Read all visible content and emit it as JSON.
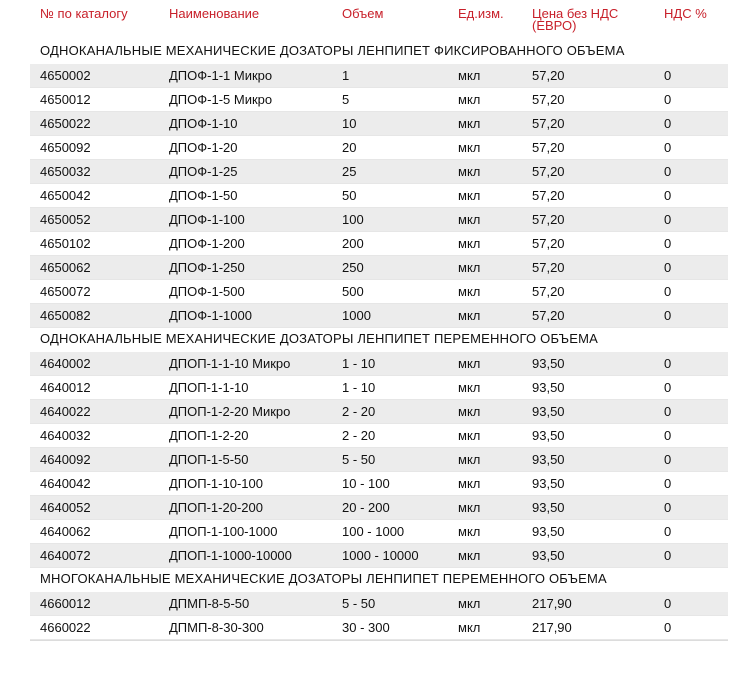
{
  "headers": {
    "catalog": "№ по каталогу",
    "name": "Наименование",
    "volume": "Объем",
    "unit": "Ед.изм.",
    "price": "Цена без НДС (ЕВРО)",
    "vat": "НДС %"
  },
  "accent_color": "#c8202a",
  "sections": [
    {
      "title": "ОДНОКАНАЛЬНЫЕ  МЕХАНИЧЕСКИЕ  ДОЗАТОРЫ  ЛЕНПИПЕТ  ФИКСИРОВАННОГО  ОБЪЕМА",
      "rows": [
        {
          "catalog": "4650002",
          "name": "ДПОФ-1-1 Микро",
          "volume": "1",
          "unit": "мкл",
          "price": "57,20",
          "vat": "0"
        },
        {
          "catalog": "4650012",
          "name": "ДПОФ-1-5 Микро",
          "volume": "5",
          "unit": "мкл",
          "price": "57,20",
          "vat": "0"
        },
        {
          "catalog": "4650022",
          "name": "ДПОФ-1-10",
          "volume": "10",
          "unit": "мкл",
          "price": "57,20",
          "vat": "0"
        },
        {
          "catalog": "4650092",
          "name": "ДПОФ-1-20",
          "volume": "20",
          "unit": "мкл",
          "price": "57,20",
          "vat": "0"
        },
        {
          "catalog": "4650032",
          "name": "ДПОФ-1-25",
          "volume": "25",
          "unit": "мкл",
          "price": "57,20",
          "vat": "0"
        },
        {
          "catalog": "4650042",
          "name": "ДПОФ-1-50",
          "volume": "50",
          "unit": "мкл",
          "price": "57,20",
          "vat": "0"
        },
        {
          "catalog": "4650052",
          "name": "ДПОФ-1-100",
          "volume": "100",
          "unit": "мкл",
          "price": "57,20",
          "vat": "0"
        },
        {
          "catalog": "4650102",
          "name": "ДПОФ-1-200",
          "volume": "200",
          "unit": "мкл",
          "price": "57,20",
          "vat": "0"
        },
        {
          "catalog": "4650062",
          "name": "ДПОФ-1-250",
          "volume": "250",
          "unit": "мкл",
          "price": "57,20",
          "vat": "0"
        },
        {
          "catalog": "4650072",
          "name": "ДПОФ-1-500",
          "volume": "500",
          "unit": "мкл",
          "price": "57,20",
          "vat": "0"
        },
        {
          "catalog": "4650082",
          "name": "ДПОФ-1-1000",
          "volume": "1000",
          "unit": "мкл",
          "price": "57,20",
          "vat": "0"
        }
      ]
    },
    {
      "title": "ОДНОКАНАЛЬНЫЕ МЕХАНИЧЕСКИЕ  ДОЗАТОРЫ  ЛЕНПИПЕТ  ПЕРЕМЕННОГО  ОБЪЕМА",
      "rows": [
        {
          "catalog": "4640002",
          "name": "ДПОП-1-1-10 Микро",
          "volume": "1 - 10",
          "unit": "мкл",
          "price": "93,50",
          "vat": "0"
        },
        {
          "catalog": "4640012",
          "name": "ДПОП-1-1-10",
          "volume": "1 - 10",
          "unit": "мкл",
          "price": "93,50",
          "vat": "0"
        },
        {
          "catalog": "4640022",
          "name": "ДПОП-1-2-20 Микро",
          "volume": "2 - 20",
          "unit": "мкл",
          "price": "93,50",
          "vat": "0"
        },
        {
          "catalog": "4640032",
          "name": "ДПОП-1-2-20",
          "volume": "2 - 20",
          "unit": "мкл",
          "price": "93,50",
          "vat": "0"
        },
        {
          "catalog": "4640092",
          "name": "ДПОП-1-5-50",
          "volume": "5 - 50",
          "unit": "мкл",
          "price": "93,50",
          "vat": "0"
        },
        {
          "catalog": "4640042",
          "name": "ДПОП-1-10-100",
          "volume": "10 - 100",
          "unit": "мкл",
          "price": "93,50",
          "vat": "0"
        },
        {
          "catalog": "4640052",
          "name": "ДПОП-1-20-200",
          "volume": "20 - 200",
          "unit": "мкл",
          "price": "93,50",
          "vat": "0"
        },
        {
          "catalog": "4640062",
          "name": "ДПОП-1-100-1000",
          "volume": "100 - 1000",
          "unit": "мкл",
          "price": "93,50",
          "vat": "0"
        },
        {
          "catalog": "4640072",
          "name": "ДПОП-1-1000-10000",
          "volume": "1000 - 10000",
          "unit": "мкл",
          "price": "93,50",
          "vat": "0"
        }
      ]
    },
    {
      "title": "МНОГОКАНАЛЬНЫЕ МЕХАНИЧЕСКИЕ ДОЗАТОРЫ  ЛЕНПИПЕТ  ПЕРЕМЕННОГО ОБЪЕМА",
      "rows": [
        {
          "catalog": "4660012",
          "name": "ДПМП-8-5-50",
          "volume": "5 - 50",
          "unit": "мкл",
          "price": "217,90",
          "vat": "0"
        },
        {
          "catalog": "4660022",
          "name": "ДПМП-8-30-300",
          "volume": "30 - 300",
          "unit": "мкл",
          "price": "217,90",
          "vat": "0"
        }
      ]
    }
  ]
}
